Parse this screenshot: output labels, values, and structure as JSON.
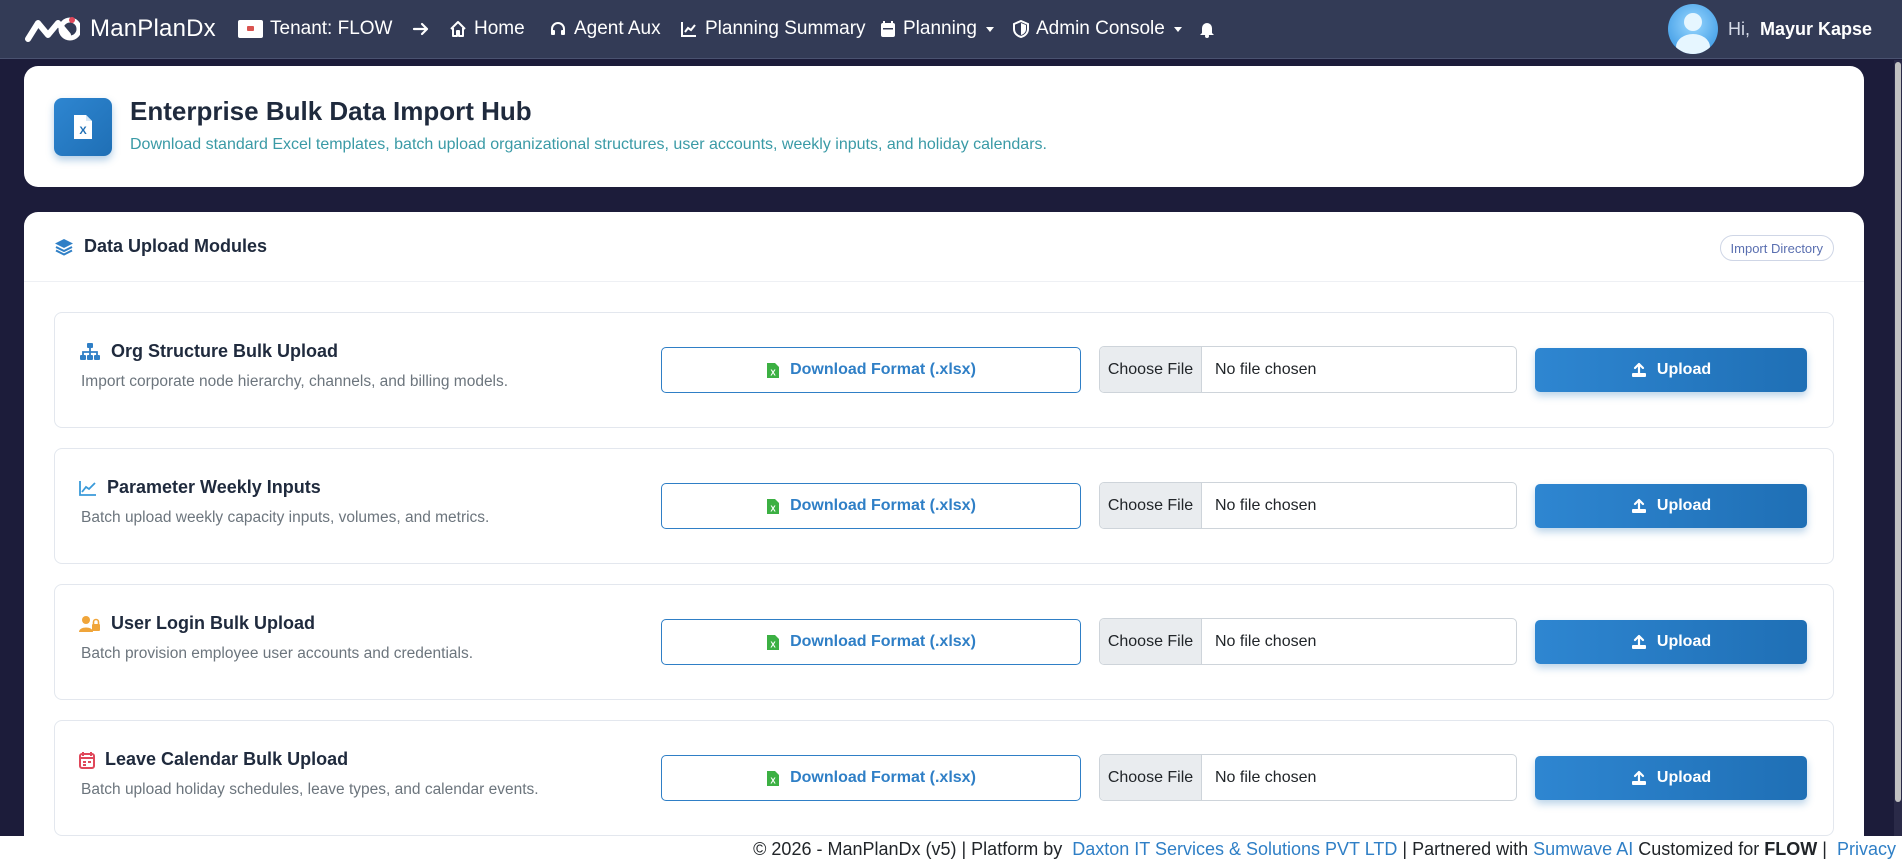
{
  "navbar": {
    "brand": "ManPlanDx",
    "tenant": "Tenant: FLOW",
    "items": {
      "home": "Home",
      "agent_aux": "Agent Aux",
      "planning_summary": "Planning Summary",
      "planning": "Planning",
      "admin_console": "Admin Console"
    },
    "user": {
      "greeting": "Hi,",
      "name": "Mayur Kapse"
    }
  },
  "hero": {
    "title": "Enterprise Bulk Data Import Hub",
    "subtitle": "Download standard Excel templates, batch upload organizational structures, user accounts, weekly inputs, and holiday calendars."
  },
  "modules": {
    "title": "Data Upload Modules",
    "badge": "Import Directory",
    "rows": [
      {
        "title": "Org Structure Bulk Upload",
        "desc": "Import corporate node hierarchy, channels, and billing models.",
        "icon": "sitemap-icon",
        "icon_color": "#2f7fc6",
        "download": "Download Format (.xlsx)",
        "choose": "Choose File",
        "file": "No file chosen",
        "upload": "Upload"
      },
      {
        "title": "Parameter Weekly Inputs",
        "desc": "Batch upload weekly capacity inputs, volumes, and metrics.",
        "icon": "chart-line-icon",
        "icon_color": "#3a9ad9",
        "download": "Download Format (.xlsx)",
        "choose": "Choose File",
        "file": "No file chosen",
        "upload": "Upload"
      },
      {
        "title": "User Login Bulk Upload",
        "desc": "Batch provision employee user accounts and credentials.",
        "icon": "user-lock-icon",
        "icon_color": "#f0a53a",
        "download": "Download Format (.xlsx)",
        "choose": "Choose File",
        "file": "No file chosen",
        "upload": "Upload"
      },
      {
        "title": "Leave Calendar Bulk Upload",
        "desc": "Batch upload holiday schedules, leave types, and calendar events.",
        "icon": "calendar-icon",
        "icon_color": "#e0475a",
        "download": "Download Format (.xlsx)",
        "choose": "Choose File",
        "file": "No file chosen",
        "upload": "Upload"
      }
    ]
  },
  "footer": {
    "prefix": "© 2026 - ManPlanDx (v5) | Platform by",
    "company": "Daxton IT Services & Solutions PVT LTD",
    "partnered": "| Partnered with",
    "partner": "Sumwave AI",
    "customized": "Customized for",
    "client": "FLOW",
    "sep": "|",
    "privacy": "Privacy"
  },
  "colors": {
    "navbar": "#333b56",
    "accent": "#2f7fc6",
    "background": "#1c1c3a"
  }
}
